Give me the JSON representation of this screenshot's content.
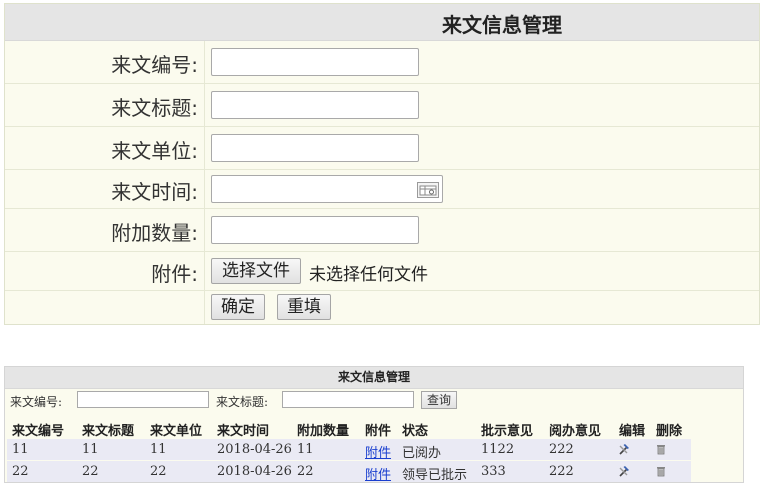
{
  "form": {
    "title": "来文信息管理",
    "fields": {
      "number_label": "来文编号:",
      "title_label": "来文标题:",
      "unit_label": "来文单位:",
      "time_label": "来文时间:",
      "count_label": "附加数量:",
      "attach_label": "附件:"
    },
    "file": {
      "button_label": "选择文件",
      "status": "未选择任何文件"
    },
    "actions": {
      "confirm": "确定",
      "reset": "重填"
    }
  },
  "list": {
    "title": "来文信息管理",
    "search": {
      "number_label": "来文编号:",
      "title_label": "来文标题:",
      "button": "查询"
    },
    "columns": [
      "来文编号",
      "来文标题",
      "来文单位",
      "来文时间",
      "附加数量",
      "附件",
      "状态",
      "批示意见",
      "阅办意见",
      "编辑",
      "删除"
    ],
    "rows": [
      {
        "number": "11",
        "title": "11",
        "unit": "11",
        "time": "2018-04-26",
        "count": "11",
        "attachment": "附件",
        "status": "已阅办",
        "instruction": "1122",
        "opinion": "222"
      },
      {
        "number": "22",
        "title": "22",
        "unit": "22",
        "time": "2018-04-26",
        "count": "22",
        "attachment": "附件",
        "status": "领导已批示",
        "instruction": "333",
        "opinion": "222"
      }
    ],
    "icons": {
      "edit": "edit-icon",
      "delete": "delete-icon"
    }
  }
}
